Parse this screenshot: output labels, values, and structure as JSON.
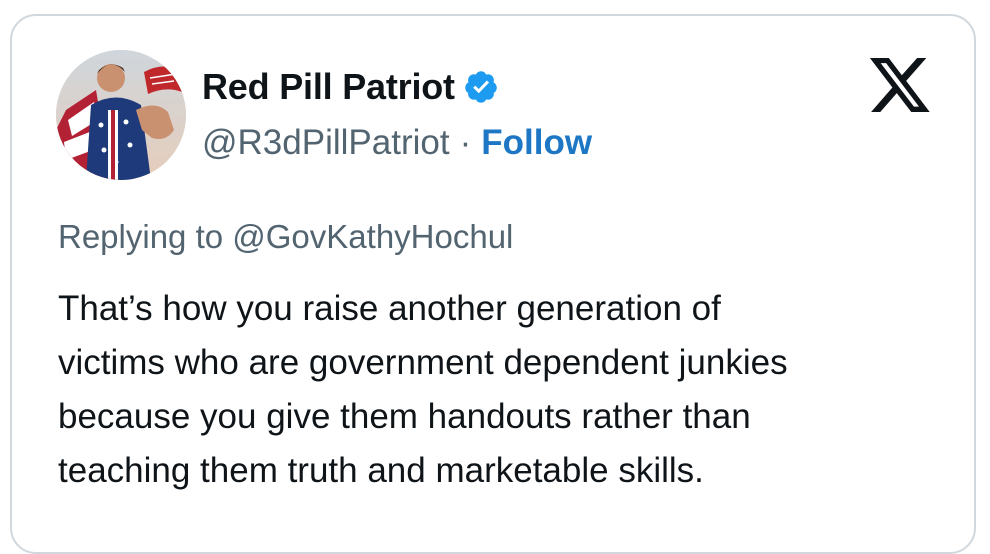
{
  "tweet": {
    "author": {
      "display_name": "Red Pill Patriot",
      "handle": "@R3dPillPatriot",
      "separator": "·",
      "follow_label": "Follow",
      "verified": true,
      "verified_color": "#1d9bf0"
    },
    "platform_icon": "x-logo-icon",
    "replying_to": "Replying to @GovKathyHochul",
    "text_lines": [
      "That’s how you raise another generation of",
      "victims who are government dependent junkies",
      "because you give them handouts rather than",
      "teaching them truth and marketable skills."
    ]
  },
  "colors": {
    "text_primary": "#0f1419",
    "text_secondary": "#536471",
    "link_blue": "#1d77c4",
    "card_border": "#d0d8de"
  }
}
